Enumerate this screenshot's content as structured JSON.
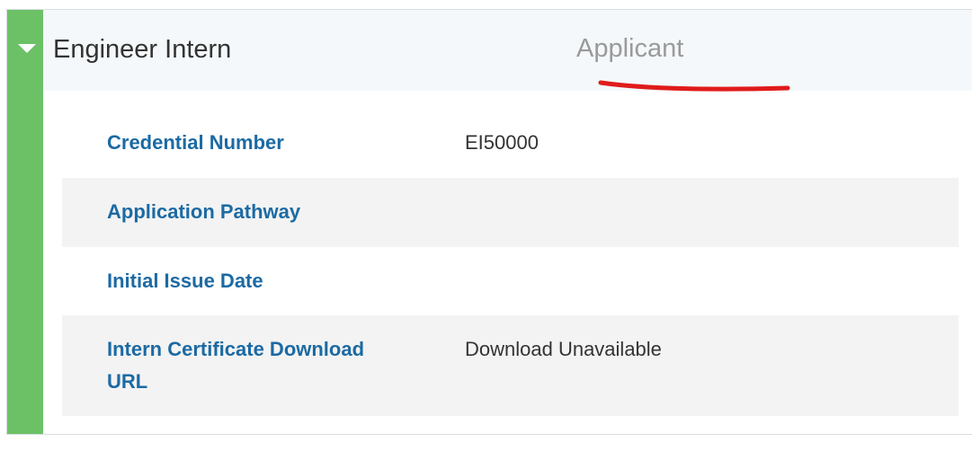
{
  "header": {
    "title": "Engineer Intern",
    "role": "Applicant"
  },
  "colors": {
    "status_bar": "#6cc166",
    "label": "#1c6aa3",
    "underline_annotation": "#e01b1b"
  },
  "icons": {
    "toggle": "caret-down-icon"
  },
  "details": [
    {
      "label": "Credential Number",
      "value": "EI50000"
    },
    {
      "label": "Application Pathway",
      "value": ""
    },
    {
      "label": "Initial Issue Date",
      "value": ""
    },
    {
      "label": "Intern Certificate Download URL",
      "value": "Download Unavailable"
    }
  ]
}
